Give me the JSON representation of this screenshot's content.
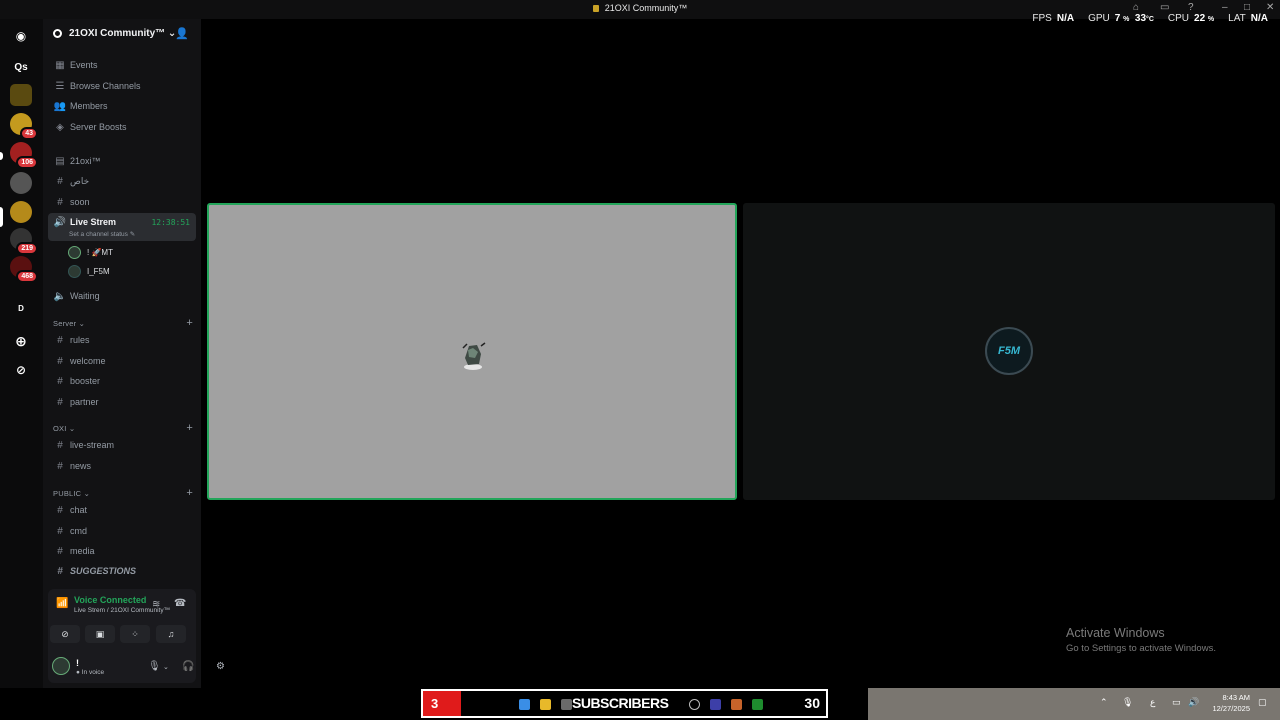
{
  "window": {
    "title": "21OXI Community™"
  },
  "perf": {
    "fps_label": "FPS",
    "fps_value": "N/A",
    "gpu_label": "GPU",
    "gpu_value": "7",
    "gpu_unit": "%",
    "gpu_temp": "33",
    "gpu_temp_unit": "°C",
    "cpu_label": "CPU",
    "cpu_value": "22",
    "cpu_unit": "%",
    "lat_label": "LAT",
    "lat_value": "N/A"
  },
  "rail": {
    "badges": [
      "43",
      "106",
      "219",
      "468"
    ],
    "home_label": "Qs",
    "folder_label": "D"
  },
  "guild": {
    "name": "21OXI Community™"
  },
  "nav": {
    "events": "Events",
    "browse": "Browse Channels",
    "members": "Members",
    "boosts": "Server Boosts"
  },
  "channels": {
    "oxi": "21oxi™",
    "khas": "خاص",
    "soon": "soon",
    "live": "Live Strem",
    "live_timer": "12:38:51",
    "live_status": "Set a channel status",
    "voice_user1": "! 🚀MT",
    "voice_user2": "I_F5M",
    "waiting": "Waiting"
  },
  "cat_server": {
    "name": "Server",
    "items": [
      "rules",
      "welcome",
      "booster",
      "partner"
    ]
  },
  "cat_oxi": {
    "name": "OXI",
    "items": [
      "live-stream",
      "news"
    ]
  },
  "cat_public": {
    "name": "PUBLIC",
    "items": [
      "chat",
      "cmd",
      "media",
      "SUGGESTIONS"
    ]
  },
  "voice": {
    "status": "Voice Connected",
    "location": "Live Strem / 21OXI Community™"
  },
  "user": {
    "name": "!",
    "status": "In voice"
  },
  "stage": {
    "tile2_logo": "F5M"
  },
  "activate": {
    "line1": "Activate Windows",
    "line2": "Go to Settings to activate Windows."
  },
  "taskbar": {
    "subs_left": "3",
    "subs_label": "SUBSCRIBERS",
    "subs_right": "30",
    "time": "8:43 AM",
    "date": "12/27/2025"
  },
  "colors": {
    "accent_green": "#23a55a",
    "badge_red": "#da373c"
  }
}
